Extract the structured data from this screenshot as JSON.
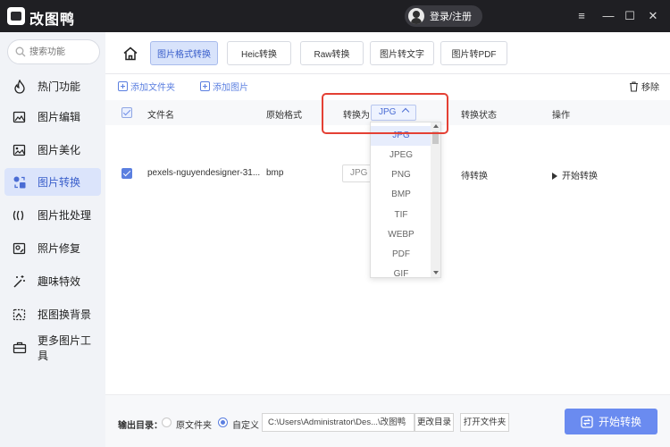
{
  "app": {
    "name": "改图鸭",
    "login": "登录/注册",
    "window_controls": [
      "≡",
      "—",
      "☐",
      "✕"
    ]
  },
  "sidebar": {
    "search_placeholder": "搜索功能",
    "items": [
      {
        "label": "热门功能",
        "icon": "fire-icon"
      },
      {
        "label": "图片编辑",
        "icon": "image-edit-icon"
      },
      {
        "label": "图片美化",
        "icon": "image-beautify-icon"
      },
      {
        "label": "图片转换",
        "icon": "image-convert-icon",
        "active": true
      },
      {
        "label": "图片批处理",
        "icon": "batch-icon"
      },
      {
        "label": "照片修复",
        "icon": "photo-repair-icon"
      },
      {
        "label": "趣味特效",
        "icon": "magic-icon"
      },
      {
        "label": "抠图换背景",
        "icon": "cutout-icon"
      },
      {
        "label": "更多图片工具",
        "icon": "toolbox-icon"
      }
    ]
  },
  "tabs": [
    {
      "label": "图片格式转换",
      "active": true
    },
    {
      "label": "Heic转换"
    },
    {
      "label": "Raw转换"
    },
    {
      "label": "图片转文字"
    },
    {
      "label": "图片转PDF"
    }
  ],
  "toolbar": {
    "add_folder": "添加文件夹",
    "add_image": "添加图片",
    "remove": "移除"
  },
  "table": {
    "headers": {
      "filename": "文件名",
      "original_format": "原始格式",
      "convert_to": "转换为",
      "status": "转换状态",
      "action": "操作"
    },
    "header_format_value": "JPG",
    "rows": [
      {
        "filename": "pexels-nguyendesigner-31...",
        "original_format": "bmp",
        "target": "JPG",
        "status": "待转换",
        "action": "开始转换"
      }
    ]
  },
  "dropdown": {
    "options": [
      "JPG",
      "JPEG",
      "PNG",
      "BMP",
      "TIF",
      "WEBP",
      "PDF",
      "GIF"
    ],
    "selected": "JPG"
  },
  "footer": {
    "output_label": "输出目录：",
    "option_original": "原文件夹",
    "option_custom": "自定义",
    "selected_option": "自定义",
    "path": "C:\\Users\\Administrator\\Des...\\改图鸭",
    "change_dir": "更改目录",
    "open_folder": "打开文件夹",
    "start": "开始转换"
  },
  "colors": {
    "accent": "#5b7fe0",
    "titlebar": "#1f1f23",
    "highlight": "#e44034",
    "start_button": "#6a8bf0"
  }
}
